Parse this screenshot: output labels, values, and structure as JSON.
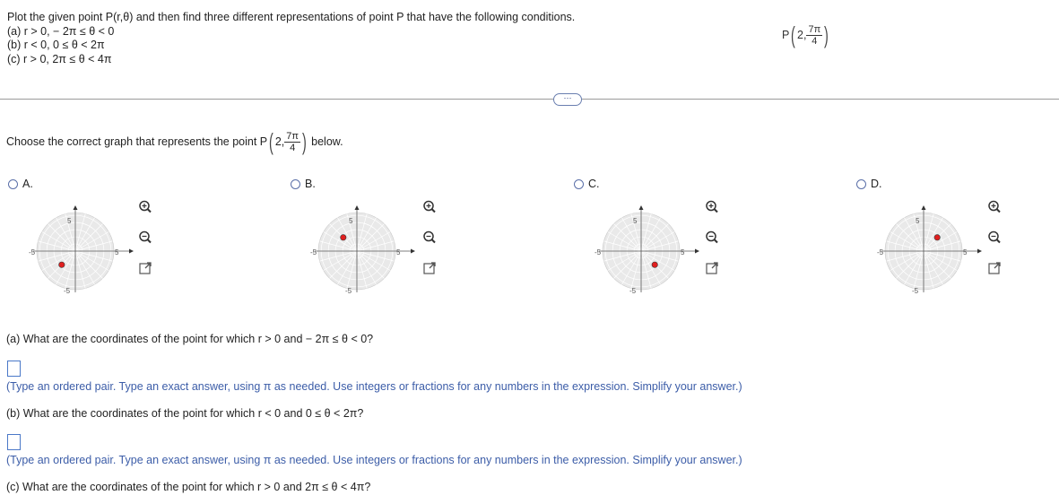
{
  "intro": {
    "line1": "Plot the given point P(r,θ) and then find three different representations of point P that have the following conditions.",
    "a": "(a) r > 0,  − 2π ≤ θ < 0",
    "b": "(b) r < 0,  0 ≤ θ < 2π",
    "c": "(c) r > 0,  2π ≤ θ < 4π"
  },
  "point": {
    "label": "P",
    "r": "2,",
    "num": "7π",
    "den": "4"
  },
  "more_button": "⋯",
  "choose": {
    "prefix": "Choose the correct graph that represents the point P",
    "suffix": "below."
  },
  "options": [
    {
      "label": "A.",
      "dot_angle_deg": 225
    },
    {
      "label": "B.",
      "dot_angle_deg": 135
    },
    {
      "label": "C.",
      "dot_angle_deg": 315
    },
    {
      "label": "D.",
      "dot_angle_deg": 45
    }
  ],
  "axis_ticks": {
    "pos": "5",
    "neg": "-5"
  },
  "questions": {
    "a": "(a) What are the coordinates of the point for which r > 0 and  − 2π ≤ θ < 0?",
    "b": "(b) What are the coordinates of the point for which r < 0 and 0 ≤ θ < 2π?",
    "c": "(c) What are the coordinates of the point for which r > 0 and 2π ≤ θ < 4π?"
  },
  "hint": "(Type an ordered pair. Type an exact answer, using π as needed. Use integers or fractions for any numbers in the expression. Simplify your answer.)",
  "icons": [
    "zoom-in-icon",
    "zoom-out-icon",
    "expand-icon"
  ],
  "colors": {
    "dot": "#e02020",
    "accent": "#3c5da8"
  }
}
